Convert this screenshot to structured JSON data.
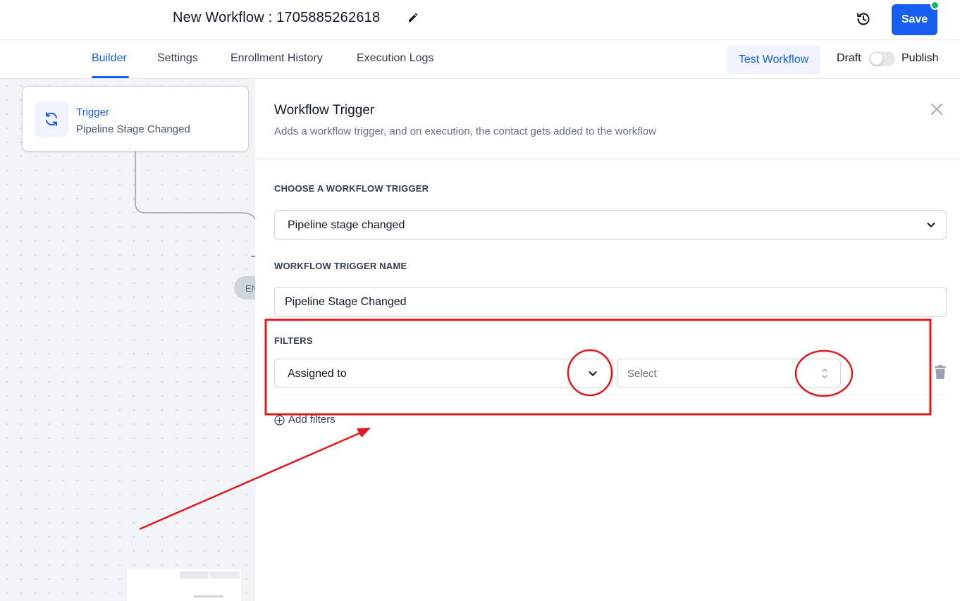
{
  "header": {
    "workflow_title": "New Workflow : 1705885262618",
    "save_label": "Save",
    "status_color": "#12b76a"
  },
  "tabs": {
    "items": [
      {
        "label": "Builder",
        "active": true
      },
      {
        "label": "Settings",
        "active": false
      },
      {
        "label": "Enrollment History",
        "active": false
      },
      {
        "label": "Execution Logs",
        "active": false
      }
    ],
    "test_workflow_label": "Test Workflow",
    "draft_label": "Draft",
    "publish_label": "Publish",
    "published": false
  },
  "canvas": {
    "trigger_card": {
      "title": "Trigger",
      "subtitle": "Pipeline Stage Changed"
    },
    "end_label": "EN"
  },
  "panel": {
    "title": "Workflow Trigger",
    "description": "Adds a workflow trigger, and on execution, the contact gets added to the workflow",
    "choose_trigger_label": "CHOOSE A WORKFLOW TRIGGER",
    "selected_trigger": "Pipeline stage changed",
    "trigger_name_label": "WORKFLOW TRIGGER NAME",
    "trigger_name_value": "Pipeline Stage Changed",
    "filters_label": "FILTERS",
    "filter": {
      "field": "Assigned to",
      "operator_placeholder": "Select"
    },
    "add_filters_label": "Add filters"
  },
  "colors": {
    "accent": "#155eef",
    "annotation": "#e0191f"
  },
  "icons": [
    "edit-icon",
    "history-icon",
    "sync-icon",
    "close-icon",
    "chevron-down-icon",
    "updown-chevron-icon",
    "trash-icon",
    "plus-circle-icon"
  ]
}
